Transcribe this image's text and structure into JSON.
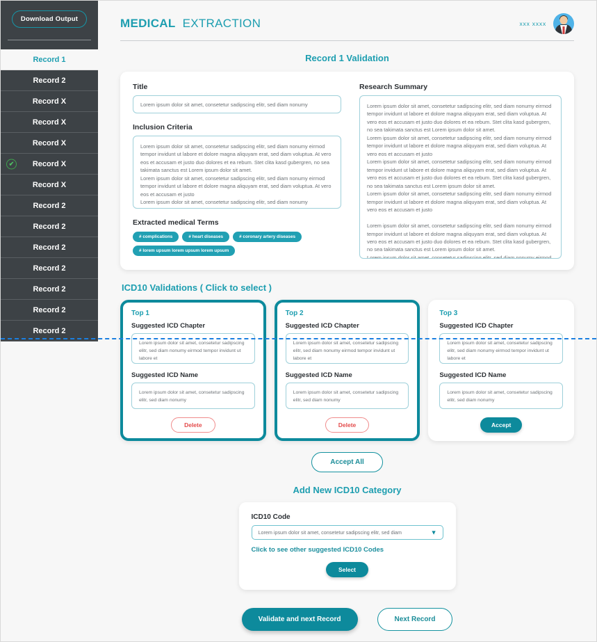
{
  "sidebar": {
    "download_label": "Download Output",
    "records": [
      {
        "label": "Record 1",
        "active": true,
        "checked": false
      },
      {
        "label": "Record 2",
        "active": false,
        "checked": false
      },
      {
        "label": "Record X",
        "active": false,
        "checked": false
      },
      {
        "label": "Record X",
        "active": false,
        "checked": false
      },
      {
        "label": "Record X",
        "active": false,
        "checked": false
      },
      {
        "label": "Record X",
        "active": false,
        "checked": true
      },
      {
        "label": "Record X",
        "active": false,
        "checked": false
      },
      {
        "label": "Record 2",
        "active": false,
        "checked": false
      },
      {
        "label": "Record 2",
        "active": false,
        "checked": false
      },
      {
        "label": "Record 2",
        "active": false,
        "checked": false
      },
      {
        "label": "Record 2",
        "active": false,
        "checked": false
      },
      {
        "label": "Record 2",
        "active": false,
        "checked": false
      },
      {
        "label": "Record 2",
        "active": false,
        "checked": false
      },
      {
        "label": "Record 2",
        "active": false,
        "checked": false
      }
    ],
    "check_icon": "check-icon"
  },
  "header": {
    "brand_bold": "MEDICAL",
    "brand_light": "EXTRACTION",
    "user_name": "xxx xxxx",
    "avatar_icon": "user-avatar-icon"
  },
  "page_title": "Record 1 Validation",
  "record": {
    "title_label": "Title",
    "title_value": "Lorem ipsum dolor sit amet, consetetur sadipscing elitr, sed diam nonumy",
    "inclusion_label": "Inclusion Criteria",
    "inclusion_value": "Lorem ipsum dolor sit amet, consetetur sadipscing elitr, sed diam nonumy eirmod tempor invidunt ut labore et dolore magna aliquyam erat, sed diam voluptua. At vero eos et accusam et justo duo dolores et ea rebum. Stet clita kasd gubergren, no sea takimata sanctus est Lorem ipsum dolor sit amet.\nLorem ipsum dolor sit amet, consetetur sadipscing elitr, sed diam nonumy eirmod tempor invidunt ut labore et dolore magna aliquyam erat, sed diam voluptua. At vero eos et accusam et justo\nLorem ipsum dolor sit amet, consetetur sadipscing elitr, sed diam nonumy",
    "summary_label": "Research Summary",
    "summary_value": "Lorem ipsum dolor sit amet, consetetur sadipscing elitr, sed diam nonumy eirmod tempor invidunt ut labore et dolore magna aliquyam erat, sed diam voluptua. At vero eos et accusam et justo duo dolores et ea rebum. Stet clita kasd gubergren, no sea takimata sanctus est Lorem ipsum dolor sit amet.\nLorem ipsum dolor sit amet, consetetur sadipscing elitr, sed diam nonumy eirmod tempor invidunt ut labore et dolore magna aliquyam erat, sed diam voluptua. At vero eos et accusam et justo\nLorem ipsum dolor sit amet, consetetur sadipscing elitr, sed diam nonumy eirmod tempor invidunt ut labore et dolore magna aliquyam erat, sed diam voluptua. At vero eos et accusam et justo duo dolores et ea rebum. Stet clita kasd gubergren, no sea takimata sanctus est Lorem ipsum dolor sit amet.\nLorem ipsum dolor sit amet, consetetur sadipscing elitr, sed diam nonumy eirmod tempor invidunt ut labore et dolore magna aliquyam erat, sed diam voluptua. At vero eos et accusam et justo\n\nLorem ipsum dolor sit amet, consetetur sadipscing elitr, sed diam nonumy eirmod tempor invidunt ut labore et dolore magna aliquyam erat, sed diam voluptua. At vero eos et accusam et justo duo dolores et ea rebum. Stet clita kasd gubergren, no sea takimata sanctus est Lorem ipsum dolor sit amet.\nLorem ipsum dolor sit amet, consetetur sadipscing elitr, sed diam nonumy eirmod tempor invidunt ut labore et dolore magna aliquyam erat, sed diam voluptua. At vero eos et accusam et justo",
    "terms_label": "Extracted medical Terms",
    "terms": [
      "# complications",
      "# heart diseases",
      "# coronary artery diseases",
      "# lorem upsum lorem upsum lorem upsum"
    ]
  },
  "icd": {
    "heading": "ICD10 Validations ( Click to select )",
    "chapter_label": "Suggested ICD Chapter",
    "name_label": "Suggested ICD Name",
    "chapter_text": "Lorem ipsum dolor sit amet, consetetur sadipscing elitr, sed diam nonumy eirmod tempor invidunt ut labore et",
    "name_text": "Lorem ipsum dolor sit amet, consetetur sadipscing elitr, sed diam nonumy",
    "cards": [
      {
        "top": "Top 1",
        "selected": true,
        "action": "Delete",
        "action_kind": "delete"
      },
      {
        "top": "Top 2",
        "selected": true,
        "action": "Delete",
        "action_kind": "delete"
      },
      {
        "top": "Top 3",
        "selected": false,
        "action": "Accept",
        "action_kind": "accept"
      }
    ],
    "accept_all_label": "Accept All"
  },
  "add_category": {
    "title": "Add New ICD10 Category",
    "code_label": "ICD10 Code",
    "code_value": "Lorem ipsum dolor sit amet, consetetur sadipscing elitr, sed diam",
    "caret_icon": "chevron-down-icon",
    "hint": "Click to see other suggested ICD10 Codes",
    "select_label": "Select"
  },
  "footer": {
    "validate_label": "Validate and next Record",
    "next_label": "Next Record"
  },
  "colors": {
    "accent": "#1d9eb0",
    "accent_dark": "#0d8a9c",
    "sidebar_bg": "#3d4246",
    "danger": "#e34b4b",
    "fold_line": "#1a7fe0",
    "tag": "#21a0b3"
  }
}
